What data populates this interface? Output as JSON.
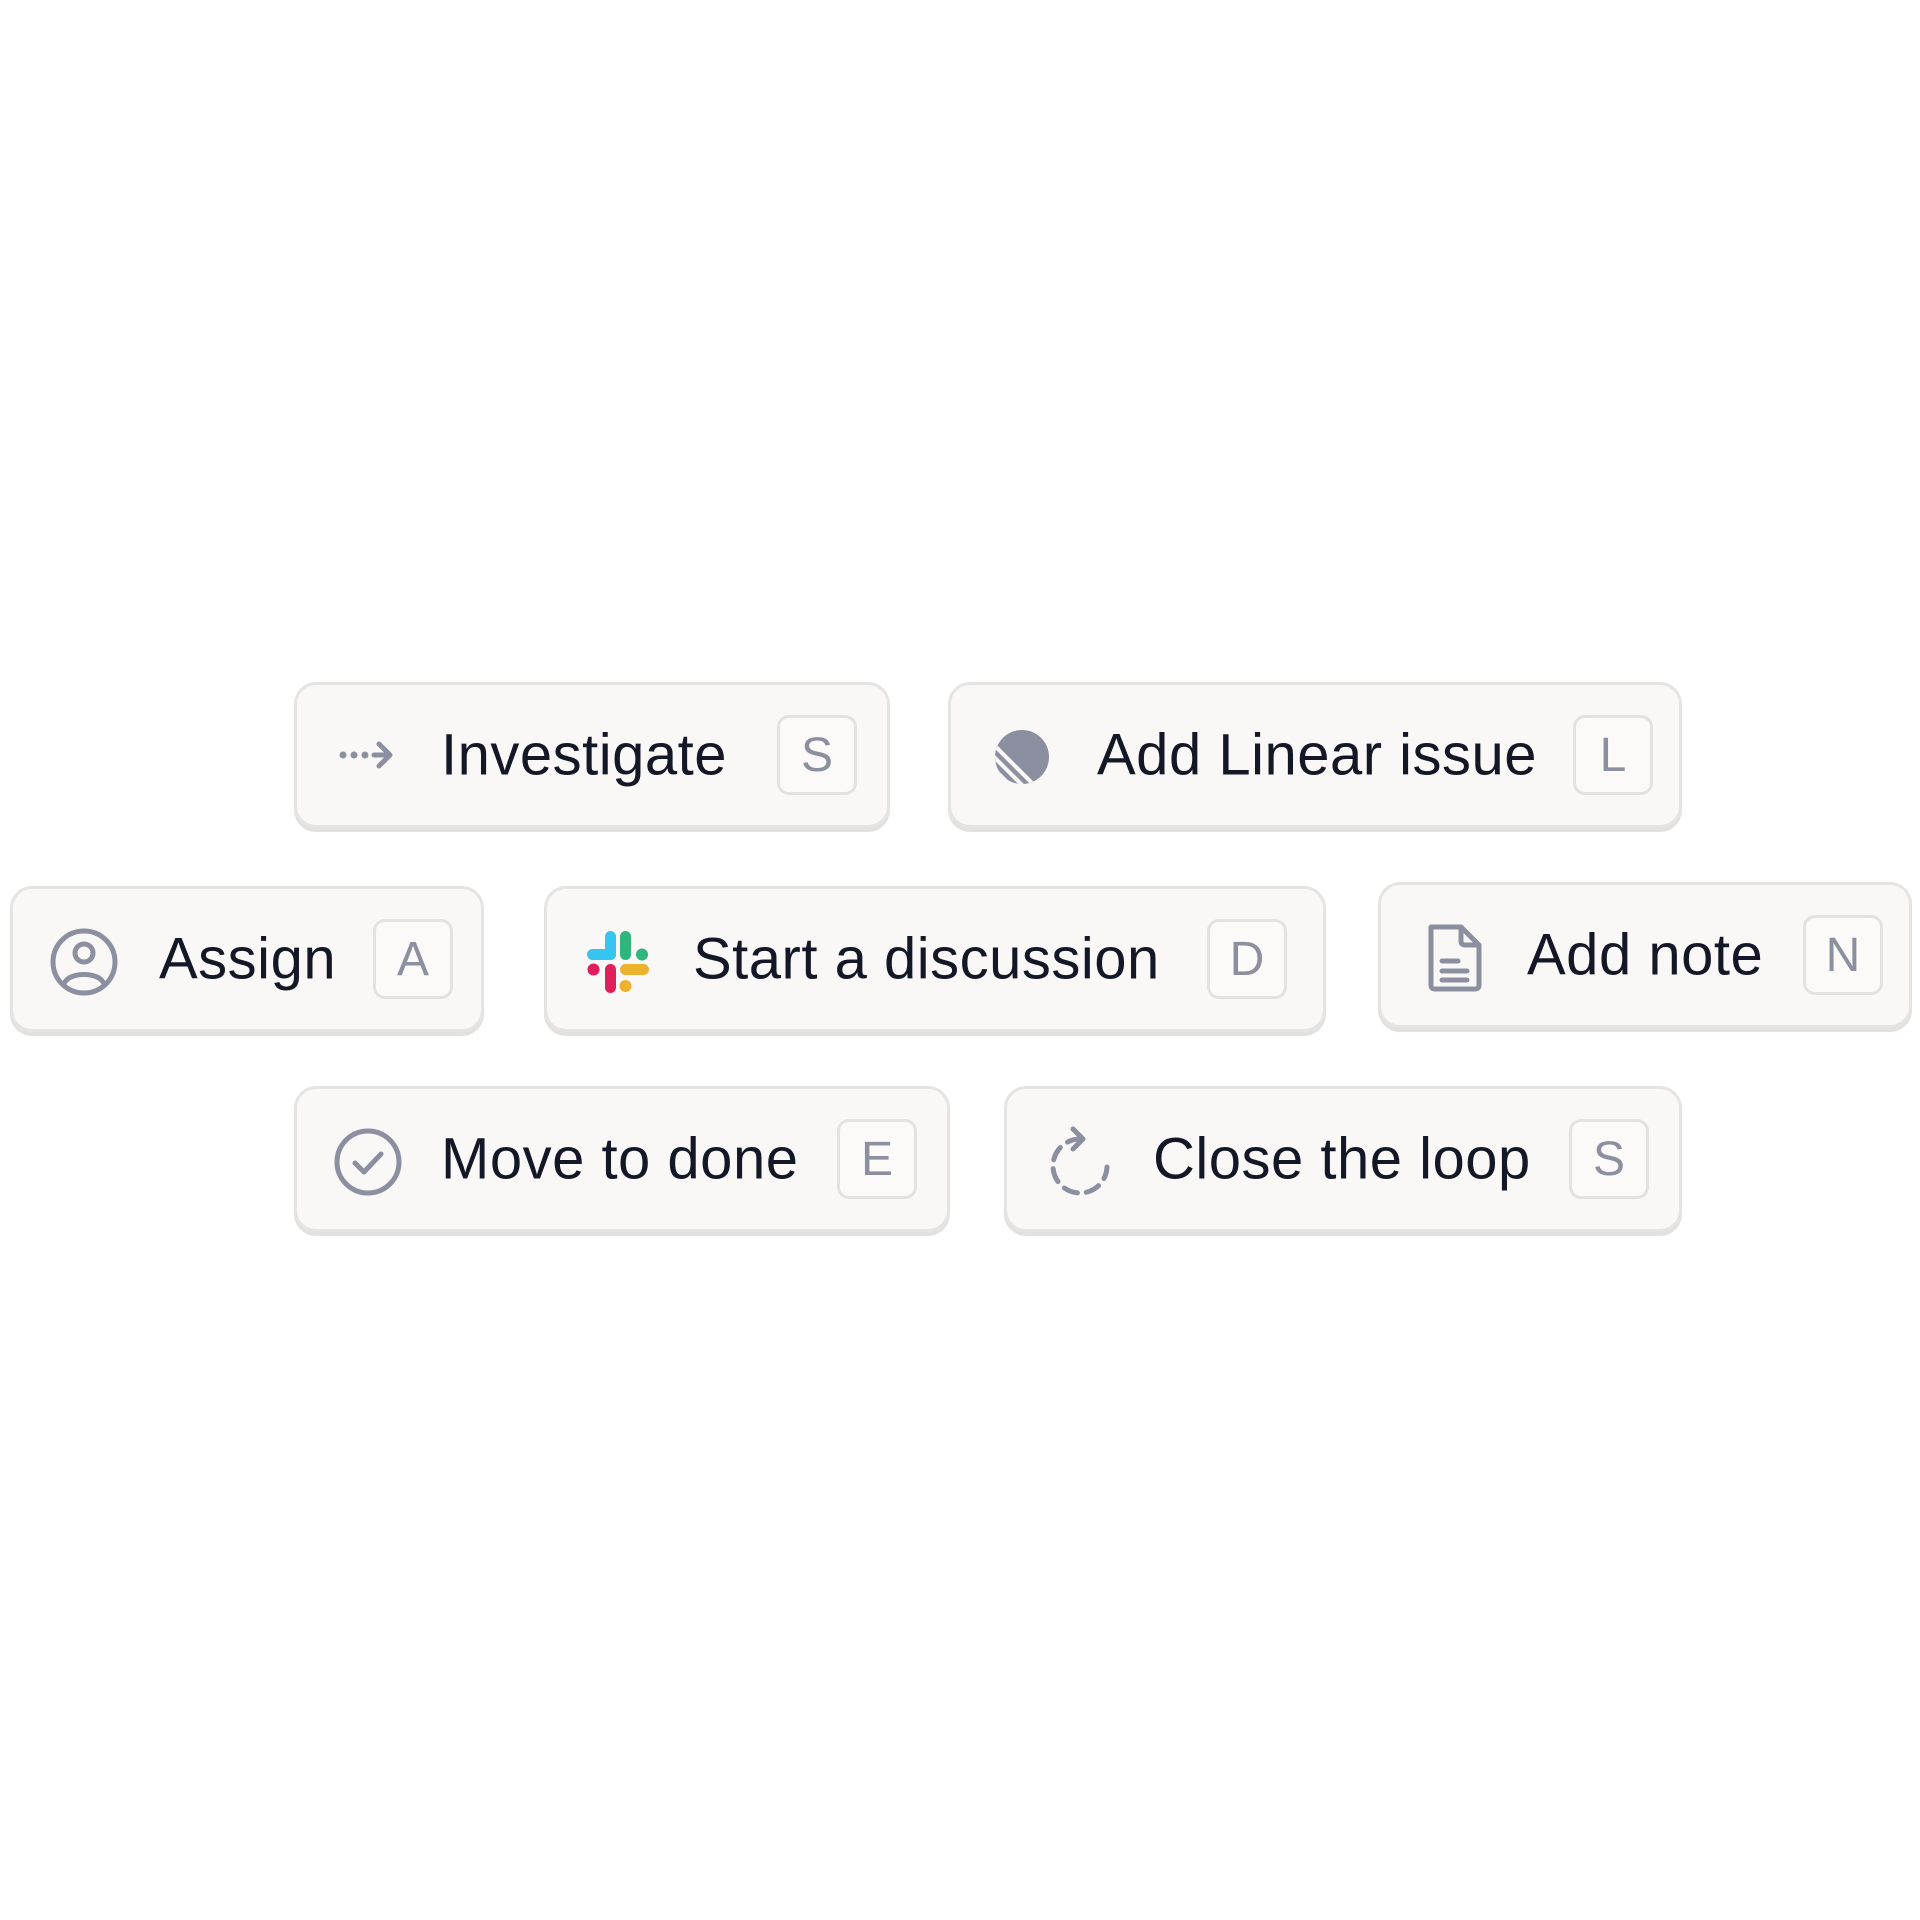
{
  "actions": {
    "investigate": {
      "label": "Investigate",
      "shortcut": "S",
      "icon": "dotted-arrow-icon"
    },
    "linear": {
      "label": "Add Linear issue",
      "shortcut": "L",
      "icon": "linear-logo-icon"
    },
    "assign": {
      "label": "Assign",
      "shortcut": "A",
      "icon": "user-circle-icon"
    },
    "discussion": {
      "label": "Start a discussion",
      "shortcut": "D",
      "icon": "slack-logo-icon"
    },
    "note": {
      "label": "Add note",
      "shortcut": "N",
      "icon": "document-icon"
    },
    "done": {
      "label": "Move to done",
      "shortcut": "E",
      "icon": "check-circle-icon"
    },
    "loop": {
      "label": "Close the loop",
      "shortcut": "S",
      "icon": "refresh-dashed-icon"
    }
  },
  "colors": {
    "icon_gray": "#8b8fa0",
    "text": "#141826",
    "button_bg": "#f9f8f7",
    "border": "#e6e4e2",
    "slack_teal": "#36c5f0",
    "slack_green": "#2eb67d",
    "slack_red": "#e01e5a",
    "slack_yellow": "#ecb22e"
  }
}
